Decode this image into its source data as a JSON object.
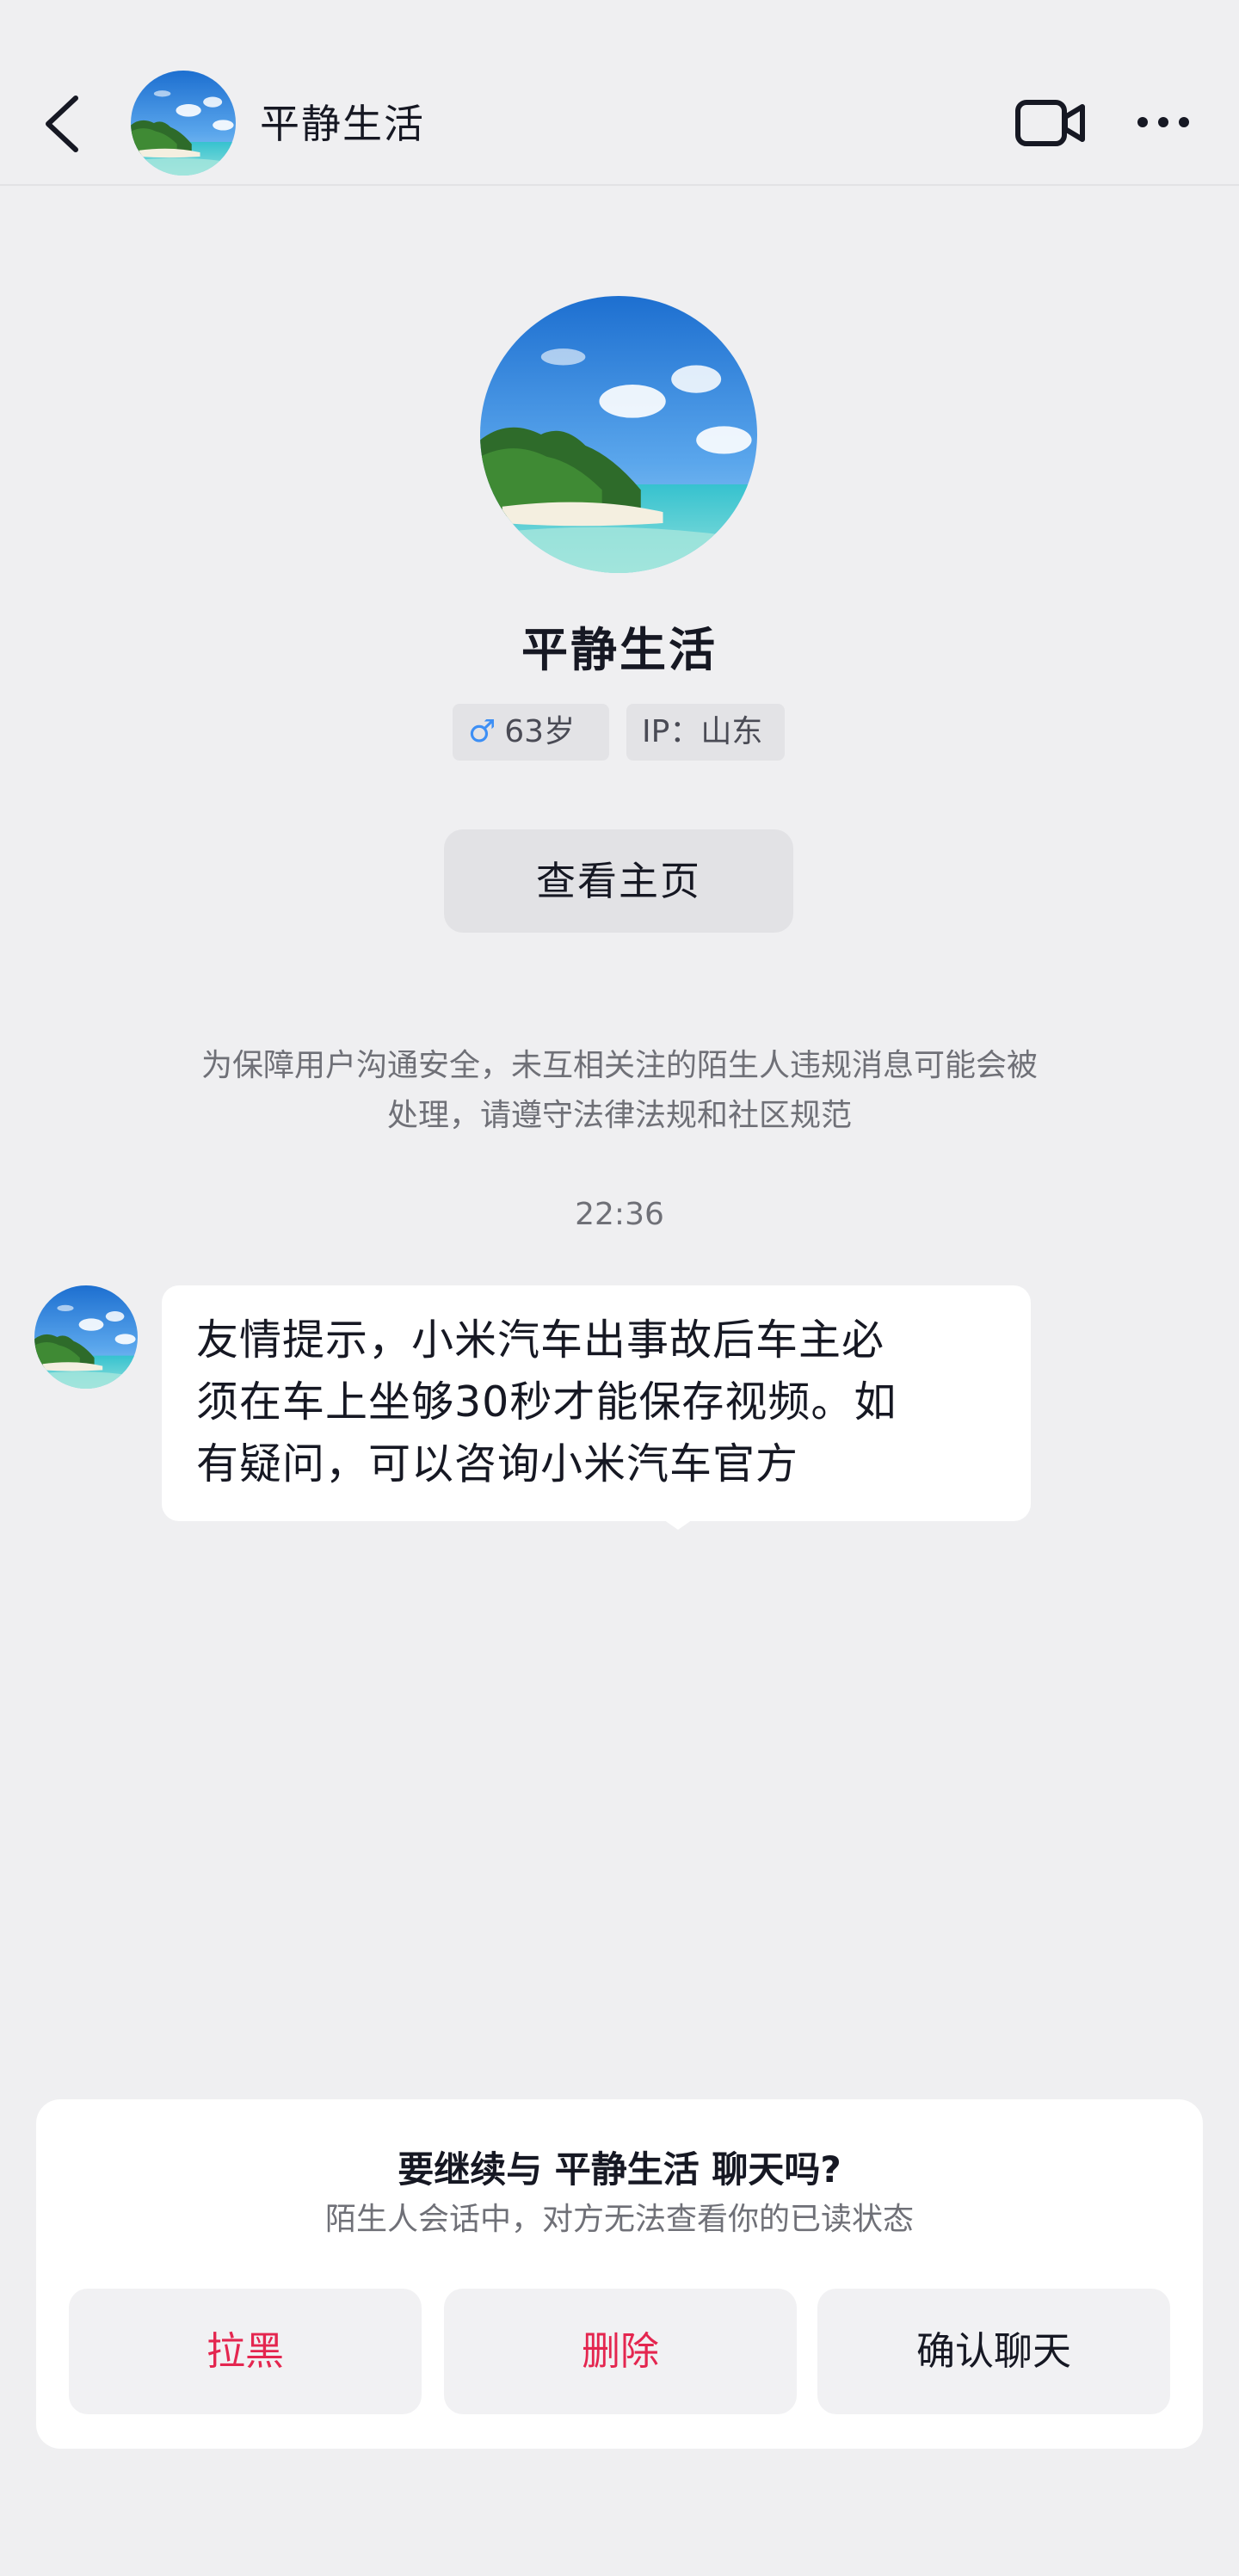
{
  "header": {
    "name": "平静生活"
  },
  "profile": {
    "name": "平静生活",
    "gender_symbol": "♂",
    "age": "63岁",
    "ip": "IP：山东",
    "homepage_button": "查看主页"
  },
  "notice": {
    "line1": "为保障用户沟通安全，未互相关注的陌生人违规消息可能会被",
    "line2": "处理，请遵守法律法规和社区规范"
  },
  "chat": {
    "timestamp": "22:36",
    "message": {
      "line1": "友情提示，小米汽车出事故后车主必",
      "line2": "须在车上坐够30秒才能保存视频。如",
      "line3": "有疑问，可以咨询小米汽车官方"
    }
  },
  "prompt": {
    "title": "要继续与 平静生活 聊天吗?",
    "subtitle": "陌生人会话中，对方无法查看你的已读状态",
    "buttons": {
      "block": "拉黑",
      "delete": "删除",
      "confirm": "确认聊天"
    }
  },
  "colors": {
    "background": "#efeff1",
    "danger": "#e4264f",
    "gender_blue": "#3d8ff5"
  },
  "icons": [
    "back-icon",
    "video-call-icon",
    "more-icon",
    "male-icon"
  ]
}
